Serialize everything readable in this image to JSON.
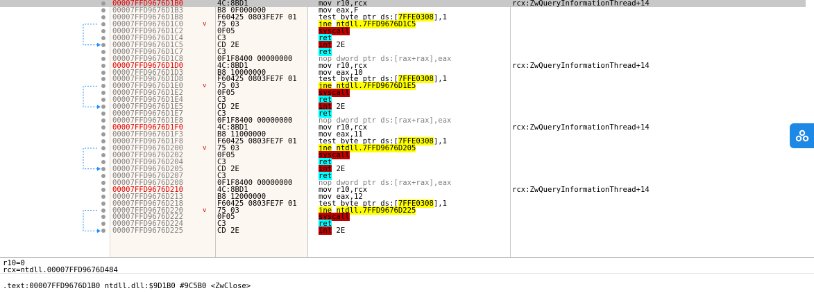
{
  "disasm_rows": [
    {
      "address": "00007FFD9676D1B0",
      "address_red": true,
      "selected": true,
      "bullet": true,
      "jump_arrow": "",
      "bytes": "4C:8BD1",
      "mnemonic": "mov",
      "mn_tag": "",
      "mn_gray": false,
      "operands": "r10,rcx",
      "operand_parts": [],
      "comment": "rcx:ZwQueryInformationThread+14"
    },
    {
      "address": "00007FFD9676D1B3",
      "address_red": false,
      "selected": false,
      "bullet": true,
      "jump_arrow": "",
      "bytes": "B8 0F000000",
      "mnemonic": "mov",
      "mn_tag": "",
      "mn_gray": false,
      "operands": "eax,F",
      "operand_parts": [],
      "comment": ""
    },
    {
      "address": "00007FFD9676D1B8",
      "address_red": false,
      "selected": false,
      "bullet": true,
      "jump_arrow": "",
      "bytes": "F60425 0803FE7F 01",
      "mnemonic": "test",
      "mn_tag": "",
      "mn_gray": false,
      "operands": "",
      "operand_parts": [
        "byte ptr ds:[",
        "7FFE0308",
        "],1"
      ],
      "comment": ""
    },
    {
      "address": "00007FFD9676D1C0",
      "address_red": false,
      "selected": false,
      "bullet": true,
      "jump_arrow": "v",
      "bytes": "75 03",
      "mnemonic": "jne",
      "mn_tag": "jne",
      "mn_gray": false,
      "operands": "ntdll.7FFD9676D1C5",
      "operand_parts": [],
      "comment": ""
    },
    {
      "address": "00007FFD9676D1C2",
      "address_red": false,
      "selected": false,
      "bullet": true,
      "jump_arrow": "",
      "bytes": "0F05",
      "mnemonic": "syscall",
      "mn_tag": "syscall",
      "mn_gray": false,
      "operands": "",
      "operand_parts": [],
      "comment": ""
    },
    {
      "address": "00007FFD9676D1C4",
      "address_red": false,
      "selected": false,
      "bullet": true,
      "jump_arrow": "",
      "bytes": "C3",
      "mnemonic": "ret",
      "mn_tag": "ret",
      "mn_gray": false,
      "operands": "",
      "operand_parts": [],
      "comment": ""
    },
    {
      "address": "00007FFD9676D1C5",
      "address_red": false,
      "selected": false,
      "bullet": true,
      "jump_arrow": "",
      "bytes": "CD 2E",
      "mnemonic": "int",
      "mn_tag": "int",
      "mn_gray": false,
      "operands": "2E",
      "operand_parts": [],
      "comment": ""
    },
    {
      "address": "00007FFD9676D1C7",
      "address_red": false,
      "selected": false,
      "bullet": true,
      "jump_arrow": "",
      "bytes": "C3",
      "mnemonic": "ret",
      "mn_tag": "ret",
      "mn_gray": false,
      "operands": "",
      "operand_parts": [],
      "comment": ""
    },
    {
      "address": "00007FFD9676D1C8",
      "address_red": false,
      "selected": false,
      "bullet": true,
      "jump_arrow": "",
      "bytes": "0F1F8400 00000000",
      "mnemonic": "nop",
      "mn_tag": "",
      "mn_gray": true,
      "operands": "dword ptr ds:[rax+rax],eax",
      "operand_parts": [],
      "comment": ""
    },
    {
      "address": "00007FFD9676D1D0",
      "address_red": true,
      "selected": false,
      "bullet": true,
      "jump_arrow": "",
      "bytes": "4C:8BD1",
      "mnemonic": "mov",
      "mn_tag": "",
      "mn_gray": false,
      "operands": "r10,rcx",
      "operand_parts": [],
      "comment": "rcx:ZwQueryInformationThread+14"
    },
    {
      "address": "00007FFD9676D1D3",
      "address_red": false,
      "selected": false,
      "bullet": true,
      "jump_arrow": "",
      "bytes": "B8 10000000",
      "mnemonic": "mov",
      "mn_tag": "",
      "mn_gray": false,
      "operands": "eax,10",
      "operand_parts": [],
      "comment": ""
    },
    {
      "address": "00007FFD9676D1D8",
      "address_red": false,
      "selected": false,
      "bullet": true,
      "jump_arrow": "",
      "bytes": "F60425 0803FE7F 01",
      "mnemonic": "test",
      "mn_tag": "",
      "mn_gray": false,
      "operands": "",
      "operand_parts": [
        "byte ptr ds:[",
        "7FFE0308",
        "],1"
      ],
      "comment": ""
    },
    {
      "address": "00007FFD9676D1E0",
      "address_red": false,
      "selected": false,
      "bullet": true,
      "jump_arrow": "v",
      "bytes": "75 03",
      "mnemonic": "jne",
      "mn_tag": "jne",
      "mn_gray": false,
      "operands": "ntdll.7FFD9676D1E5",
      "operand_parts": [],
      "comment": ""
    },
    {
      "address": "00007FFD9676D1E2",
      "address_red": false,
      "selected": false,
      "bullet": true,
      "jump_arrow": "",
      "bytes": "0F05",
      "mnemonic": "syscall",
      "mn_tag": "syscall",
      "mn_gray": false,
      "operands": "",
      "operand_parts": [],
      "comment": ""
    },
    {
      "address": "00007FFD9676D1E4",
      "address_red": false,
      "selected": false,
      "bullet": true,
      "jump_arrow": "",
      "bytes": "C3",
      "mnemonic": "ret",
      "mn_tag": "ret",
      "mn_gray": false,
      "operands": "",
      "operand_parts": [],
      "comment": ""
    },
    {
      "address": "00007FFD9676D1E5",
      "address_red": false,
      "selected": false,
      "bullet": true,
      "jump_arrow": "",
      "bytes": "CD 2E",
      "mnemonic": "int",
      "mn_tag": "int",
      "mn_gray": false,
      "operands": "2E",
      "operand_parts": [],
      "comment": ""
    },
    {
      "address": "00007FFD9676D1E7",
      "address_red": false,
      "selected": false,
      "bullet": true,
      "jump_arrow": "",
      "bytes": "C3",
      "mnemonic": "ret",
      "mn_tag": "ret",
      "mn_gray": false,
      "operands": "",
      "operand_parts": [],
      "comment": ""
    },
    {
      "address": "00007FFD9676D1E8",
      "address_red": false,
      "selected": false,
      "bullet": true,
      "jump_arrow": "",
      "bytes": "0F1F8400 00000000",
      "mnemonic": "nop",
      "mn_tag": "",
      "mn_gray": true,
      "operands": "dword ptr ds:[rax+rax],eax",
      "operand_parts": [],
      "comment": ""
    },
    {
      "address": "00007FFD9676D1F0",
      "address_red": true,
      "selected": false,
      "bullet": true,
      "jump_arrow": "",
      "bytes": "4C:8BD1",
      "mnemonic": "mov",
      "mn_tag": "",
      "mn_gray": false,
      "operands": "r10,rcx",
      "operand_parts": [],
      "comment": "rcx:ZwQueryInformationThread+14"
    },
    {
      "address": "00007FFD9676D1F3",
      "address_red": false,
      "selected": false,
      "bullet": true,
      "jump_arrow": "",
      "bytes": "B8 11000000",
      "mnemonic": "mov",
      "mn_tag": "",
      "mn_gray": false,
      "operands": "eax,11",
      "operand_parts": [],
      "comment": ""
    },
    {
      "address": "00007FFD9676D1F8",
      "address_red": false,
      "selected": false,
      "bullet": true,
      "jump_arrow": "",
      "bytes": "F60425 0803FE7F 01",
      "mnemonic": "test",
      "mn_tag": "",
      "mn_gray": false,
      "operands": "",
      "operand_parts": [
        "byte ptr ds:[",
        "7FFE0308",
        "],1"
      ],
      "comment": ""
    },
    {
      "address": "00007FFD9676D200",
      "address_red": false,
      "selected": false,
      "bullet": true,
      "jump_arrow": "v",
      "bytes": "75 03",
      "mnemonic": "jne",
      "mn_tag": "jne",
      "mn_gray": false,
      "operands": "ntdll.7FFD9676D205",
      "operand_parts": [],
      "comment": ""
    },
    {
      "address": "00007FFD9676D202",
      "address_red": false,
      "selected": false,
      "bullet": true,
      "jump_arrow": "",
      "bytes": "0F05",
      "mnemonic": "syscall",
      "mn_tag": "syscall",
      "mn_gray": false,
      "operands": "",
      "operand_parts": [],
      "comment": ""
    },
    {
      "address": "00007FFD9676D204",
      "address_red": false,
      "selected": false,
      "bullet": true,
      "jump_arrow": "",
      "bytes": "C3",
      "mnemonic": "ret",
      "mn_tag": "ret",
      "mn_gray": false,
      "operands": "",
      "operand_parts": [],
      "comment": ""
    },
    {
      "address": "00007FFD9676D205",
      "address_red": false,
      "selected": false,
      "bullet": true,
      "jump_arrow": "",
      "bytes": "CD 2E",
      "mnemonic": "int",
      "mn_tag": "int",
      "mn_gray": false,
      "operands": "2E",
      "operand_parts": [],
      "comment": ""
    },
    {
      "address": "00007FFD9676D207",
      "address_red": false,
      "selected": false,
      "bullet": true,
      "jump_arrow": "",
      "bytes": "C3",
      "mnemonic": "ret",
      "mn_tag": "ret",
      "mn_gray": false,
      "operands": "",
      "operand_parts": [],
      "comment": ""
    },
    {
      "address": "00007FFD9676D208",
      "address_red": false,
      "selected": false,
      "bullet": true,
      "jump_arrow": "",
      "bytes": "0F1F8400 00000000",
      "mnemonic": "nop",
      "mn_tag": "",
      "mn_gray": true,
      "operands": "dword ptr ds:[rax+rax],eax",
      "operand_parts": [],
      "comment": ""
    },
    {
      "address": "00007FFD9676D210",
      "address_red": true,
      "selected": false,
      "bullet": true,
      "jump_arrow": "",
      "bytes": "4C:8BD1",
      "mnemonic": "mov",
      "mn_tag": "",
      "mn_gray": false,
      "operands": "r10,rcx",
      "operand_parts": [],
      "comment": "rcx:ZwQueryInformationThread+14"
    },
    {
      "address": "00007FFD9676D213",
      "address_red": false,
      "selected": false,
      "bullet": true,
      "jump_arrow": "",
      "bytes": "B8 12000000",
      "mnemonic": "mov",
      "mn_tag": "",
      "mn_gray": false,
      "operands": "eax,12",
      "operand_parts": [],
      "comment": ""
    },
    {
      "address": "00007FFD9676D218",
      "address_red": false,
      "selected": false,
      "bullet": true,
      "jump_arrow": "",
      "bytes": "F60425 0803FE7F 01",
      "mnemonic": "test",
      "mn_tag": "",
      "mn_gray": false,
      "operands": "",
      "operand_parts": [
        "byte ptr ds:[",
        "7FFE0308",
        "],1"
      ],
      "comment": ""
    },
    {
      "address": "00007FFD9676D220",
      "address_red": false,
      "selected": false,
      "bullet": true,
      "jump_arrow": "v",
      "bytes": "75 03",
      "mnemonic": "jne",
      "mn_tag": "jne",
      "mn_gray": false,
      "operands": "ntdll.7FFD9676D225",
      "operand_parts": [],
      "comment": ""
    },
    {
      "address": "00007FFD9676D222",
      "address_red": false,
      "selected": false,
      "bullet": true,
      "jump_arrow": "",
      "bytes": "0F05",
      "mnemonic": "syscall",
      "mn_tag": "syscall",
      "mn_gray": false,
      "operands": "",
      "operand_parts": [],
      "comment": ""
    },
    {
      "address": "00007FFD9676D224",
      "address_red": false,
      "selected": false,
      "bullet": true,
      "jump_arrow": "",
      "bytes": "C3",
      "mnemonic": "ret",
      "mn_tag": "ret",
      "mn_gray": false,
      "operands": "",
      "operand_parts": [],
      "comment": ""
    },
    {
      "address": "00007FFD9676D225",
      "address_red": false,
      "selected": false,
      "bullet": true,
      "jump_arrow": "",
      "bytes": "CD 2E",
      "mnemonic": "int",
      "mn_tag": "int",
      "mn_gray": false,
      "operands": "2E",
      "operand_parts": [],
      "comment": ""
    }
  ],
  "info_panel": {
    "line1": "r10=0",
    "line2": "rcx=ntdll.00007FFD9676D484",
    "location": ".text:00007FFD9676D1B0 ntdll.dll:$9D1B0 #9C5B0 <ZwClose>"
  },
  "colors": {
    "address_red": "#e00000",
    "address_gray": "#808080",
    "selected_row": "#c8c8c8",
    "column_bg": "#fdf7f1",
    "jne_tag": "#ffff00",
    "ret_tag": "#00ffff",
    "syscall_int_tag": "#c00000",
    "jump_arrow": "#1e90ff",
    "float_button": "#1e88e5"
  },
  "icons": {
    "float_button": "tree-nodes-icon",
    "scroll_up": "triangle-up-icon",
    "scroll_down": "triangle-down-icon"
  }
}
